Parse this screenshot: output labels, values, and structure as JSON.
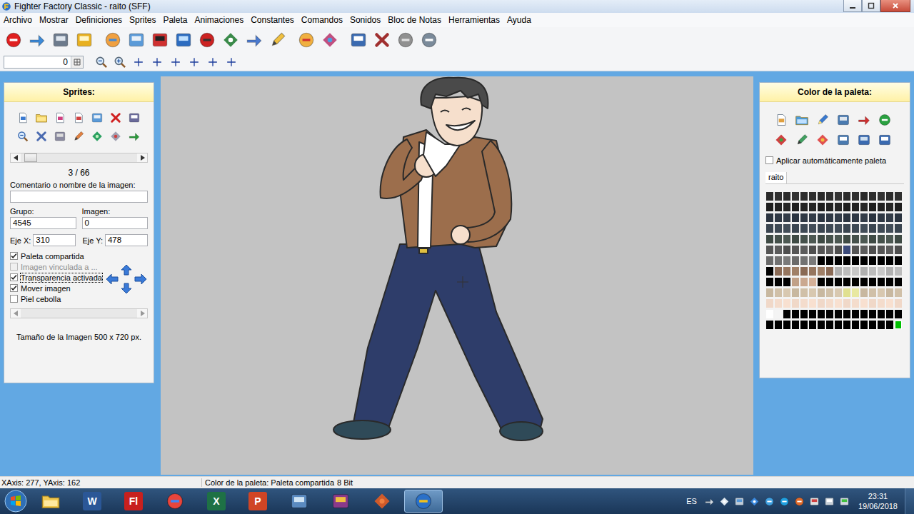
{
  "window": {
    "title": "Fighter Factory Classic - raito (SFF)"
  },
  "menu": [
    "Archivo",
    "Mostrar",
    "Definiciones",
    "Sprites",
    "Paleta",
    "Animaciones",
    "Constantes",
    "Comandos",
    "Sonidos",
    "Bloc de Notas",
    "Herramientas",
    "Ayuda"
  ],
  "toolbar2": {
    "field_value": "0"
  },
  "sprites_panel": {
    "title": "Sprites:",
    "scroll": {
      "level": 0.03,
      "has_thumb": true
    },
    "counter": "3 / 66",
    "comment_label": "Comentario o nombre de la imagen:",
    "comment_value": "",
    "group_label": "Grupo:",
    "group_value": "4545",
    "image_label": "Imagen:",
    "image_value": "0",
    "x_label": "Eje X:",
    "x_value": "310",
    "y_label": "Eje Y:",
    "y_value": "478",
    "checkboxes": [
      {
        "label": "Paleta compartida",
        "checked": true,
        "disabled": false,
        "focused": false
      },
      {
        "label": "Imagen vinculada a ...",
        "checked": false,
        "disabled": true,
        "focused": false
      },
      {
        "label": "Transparencia activada",
        "checked": true,
        "disabled": false,
        "focused": true
      },
      {
        "label": "Mover imagen",
        "checked": true,
        "disabled": false,
        "focused": false
      },
      {
        "label": "Piel cebolla",
        "checked": false,
        "disabled": false,
        "focused": false
      }
    ],
    "onion_scroll": {
      "level": 0,
      "has_thumb": false
    },
    "size_text": "Tamaño de la Imagen 500 x 720 px."
  },
  "palette_panel": {
    "title": "Color de la paleta:",
    "auto_apply": {
      "label": "Aplicar automáticamente paleta",
      "checked": false
    },
    "tabs": [
      {
        "label": "raito",
        "selected": true
      }
    ],
    "selected_cell": {
      "row": 12,
      "col": 15
    },
    "rows": [
      [
        "#2a2a2a",
        "#2e2e2e",
        "#2a2a2a",
        "#323232",
        "#2c2c2c",
        "#303030",
        "#2a2a2a",
        "#2e2e2e",
        "#343434",
        "#2c2c2c",
        "#303030",
        "#2a2a2a",
        "#2e2e2e",
        "#323232",
        "#2c2c2c",
        "#303030"
      ],
      [
        "#1e1e1e",
        "#222222",
        "#262626",
        "#1e1e1e",
        "#222222",
        "#262626",
        "#1e1e1e",
        "#222222",
        "#262626",
        "#1e1e1e",
        "#222222",
        "#262626",
        "#1e1e1e",
        "#222222",
        "#262626",
        "#1e1e1e"
      ],
      [
        "#2b3440",
        "#2f3844",
        "#333c48",
        "#2b3440",
        "#2f3844",
        "#333c48",
        "#2b3440",
        "#2f3844",
        "#333c48",
        "#2b3440",
        "#2f3844",
        "#333c48",
        "#2b3440",
        "#2f3844",
        "#333c48",
        "#2b3440"
      ],
      [
        "#3a4550",
        "#3e4954",
        "#424d58",
        "#3a4550",
        "#3e4954",
        "#424d58",
        "#3a4550",
        "#3e4954",
        "#424d58",
        "#3a4550",
        "#3e4954",
        "#424d58",
        "#3a4550",
        "#3e4954",
        "#424d58",
        "#3a4550"
      ],
      [
        "#3e4a44",
        "#45514b",
        "#4c5852",
        "#3e4a44",
        "#45514b",
        "#4c5852",
        "#3e4a44",
        "#45514b",
        "#4c5852",
        "#3e4a44",
        "#45514b",
        "#4c5852",
        "#3e4a44",
        "#45514b",
        "#4c5852",
        "#3e4a44"
      ],
      [
        "#555555",
        "#5c5c5c",
        "#4e4e4e",
        "#555555",
        "#5c5c5c",
        "#4e4e4e",
        "#555555",
        "#5c5c5c",
        "#4e4e4e",
        "#3b4a7a",
        "#555555",
        "#5c5c5c",
        "#4e4e4e",
        "#555555",
        "#5c5c5c",
        "#4e4e4e"
      ],
      [
        "#6a6a6a",
        "#727272",
        "#7a7a7a",
        "#6a6a6a",
        "#727272",
        "#7a7a7a",
        "#000000",
        "#000000",
        "#000000",
        "#000000",
        "#000000",
        "#000000",
        "#000000",
        "#000000",
        "#000000",
        "#000000"
      ],
      [
        "#000000",
        "#8a6a55",
        "#96765f",
        "#a08068",
        "#8a6a55",
        "#96765f",
        "#a08068",
        "#8a6a55",
        "#b0b0b0",
        "#bcbcbc",
        "#c8c8c8",
        "#b0b0b0",
        "#bcbcbc",
        "#c8c8c8",
        "#b0b0b0",
        "#bcbcbc"
      ],
      [
        "#000000",
        "#000000",
        "#000000",
        "#c0a088",
        "#caa890",
        "#d4b098",
        "#000000",
        "#000000",
        "#000000",
        "#000000",
        "#000000",
        "#000000",
        "#000000",
        "#000000",
        "#000000",
        "#000000"
      ],
      [
        "#c8b8a0",
        "#d0c0a8",
        "#d8c8b0",
        "#c8b8a0",
        "#d0c0a8",
        "#d8c8b0",
        "#c8b8a0",
        "#d0c0a8",
        "#d8c8b0",
        "#e0e090",
        "#e8e8a0",
        "#c8b8a0",
        "#d0c0a8",
        "#d8c8b0",
        "#c8b8a0",
        "#d0c0a8"
      ],
      [
        "#f0d8c8",
        "#f4dccc",
        "#f8e0d0",
        "#f0d8c8",
        "#f4dccc",
        "#f8e0d0",
        "#f0d8c8",
        "#f4dccc",
        "#f8e0d0",
        "#f0d8c8",
        "#f4dccc",
        "#f8e0d0",
        "#f0d8c8",
        "#f4dccc",
        "#f8e0d0",
        "#f0d8c8"
      ],
      [
        "#ffffff",
        "#f4f4f4",
        "#000000",
        "#000000",
        "#000000",
        "#000000",
        "#000000",
        "#000000",
        "#000000",
        "#000000",
        "#000000",
        "#000000",
        "#000000",
        "#000000",
        "#000000",
        "#000000"
      ],
      [
        "#000000",
        "#000000",
        "#000000",
        "#000000",
        "#000000",
        "#000000",
        "#000000",
        "#000000",
        "#000000",
        "#000000",
        "#000000",
        "#000000",
        "#000000",
        "#000000",
        "#000000",
        "#00c000"
      ]
    ]
  },
  "status_bar": [
    "XAxis: 277, YAxis: 162",
    "Color de la paleta: Paleta compartida",
    "8 Bit"
  ],
  "taskbar": {
    "apps": [
      {
        "kind": "explorer",
        "label": "",
        "active": false
      },
      {
        "kind": "word",
        "label": "W",
        "active": false
      },
      {
        "kind": "flash",
        "label": "Fl",
        "active": false
      },
      {
        "kind": "chrome",
        "label": "",
        "active": false
      },
      {
        "kind": "excel",
        "label": "X",
        "active": false
      },
      {
        "kind": "powerpoint",
        "label": "P",
        "active": false
      },
      {
        "kind": "control",
        "label": "",
        "active": false
      },
      {
        "kind": "winrar",
        "label": "",
        "active": false
      },
      {
        "kind": "glove",
        "label": "",
        "active": false
      },
      {
        "kind": "fighter-factory",
        "label": "",
        "active": true
      }
    ],
    "language": "ES",
    "time": "23:31",
    "date": "19/06/2018"
  }
}
